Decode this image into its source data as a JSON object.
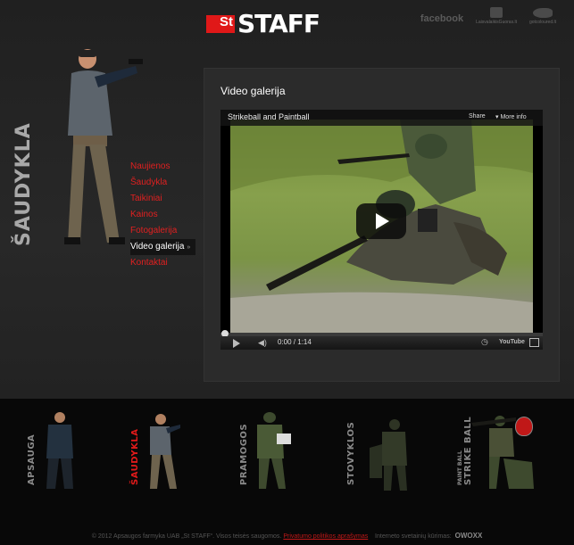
{
  "brand": {
    "logo_box": "St",
    "logo_text": "STAFF"
  },
  "top_links": {
    "facebook": "facebook",
    "site1": "LaisvalaikisGuoras.lt",
    "site2": "gotcoloured.lt"
  },
  "side_title": "ŠAUDYKLA",
  "nav": {
    "items": [
      {
        "label": "Naujienos"
      },
      {
        "label": "Šaudykla"
      },
      {
        "label": "Taikiniai"
      },
      {
        "label": "Kainos"
      },
      {
        "label": "Fotogalerija"
      },
      {
        "label": "Video galerija",
        "active": true
      },
      {
        "label": "Kontaktai"
      }
    ]
  },
  "panel": {
    "title": "Video galerija"
  },
  "player": {
    "title": "Strikeball and Paintball",
    "share": "Share",
    "more_info": "More info",
    "time": "0:00 / 1:14",
    "youtube": "YouTube",
    "progress_fraction": 0
  },
  "categories": [
    {
      "label": "APSAUGA",
      "sub": ""
    },
    {
      "label": "ŠAUDYKLA",
      "sub": "",
      "active": true
    },
    {
      "label": "PRAMOGOS",
      "sub": ""
    },
    {
      "label": "STOVYKLOS",
      "sub": ""
    },
    {
      "label": "STRIKE BALL",
      "sub": "PAINT BALL"
    }
  ],
  "footer": {
    "copyright": "© 2012 Apsaugos farmyka UAB „St STAFF“. Visos teisės saugomos.",
    "privacy": "Privatumo politikos aprašymas",
    "credit": "Interneto svetainių kūrimas:",
    "credit_brand": "OWOXX"
  },
  "colors": {
    "accent": "#e01818",
    "background": "#1c1c1c",
    "panel": "#2b2b2b"
  }
}
